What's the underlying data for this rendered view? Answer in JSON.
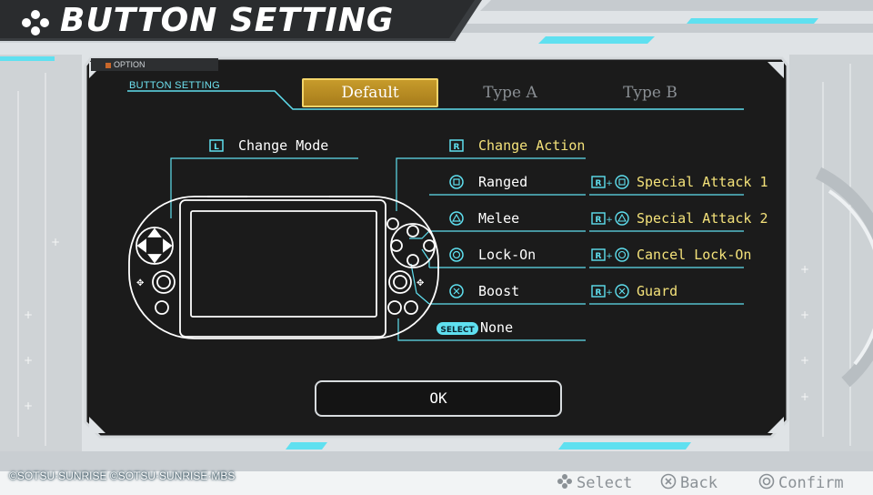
{
  "title": "BUTTON SETTING",
  "panel_tag": "OPTION",
  "section_label": "BUTTON SETTING",
  "tabs": [
    {
      "label": "Default",
      "active": true
    },
    {
      "label": "Type A",
      "active": false
    },
    {
      "label": "Type B",
      "active": false
    }
  ],
  "mappings": {
    "change_mode": {
      "button": "L",
      "label": "Change Mode"
    },
    "change_action": {
      "button": "R",
      "label": "Change Action"
    },
    "ranged": {
      "button": "square",
      "label": "Ranged"
    },
    "melee": {
      "button": "triangle",
      "label": "Melee"
    },
    "lock_on": {
      "button": "circle",
      "label": "Lock-On"
    },
    "boost": {
      "button": "cross",
      "label": "Boost"
    },
    "select": {
      "button": "SELECT",
      "label": "None"
    }
  },
  "combos": [
    {
      "button": "R+square",
      "label": "Special Attack 1"
    },
    {
      "button": "R+triangle",
      "label": "Special Attack 2"
    },
    {
      "button": "R+circle",
      "label": "Cancel Lock-On"
    },
    {
      "button": "R+cross",
      "label": "Guard"
    }
  ],
  "ok_label": "OK",
  "copyright": "©SOTSU·SUNRISE  ©SOTSU·SUNRISE·MBS",
  "footer": {
    "select": "Select",
    "back": "Back",
    "confirm": "Confirm"
  },
  "colors": {
    "accent": "#5fe0f0",
    "highlight": "#f4e27a",
    "tab_active": "#c99d2c",
    "panel": "#141414"
  }
}
